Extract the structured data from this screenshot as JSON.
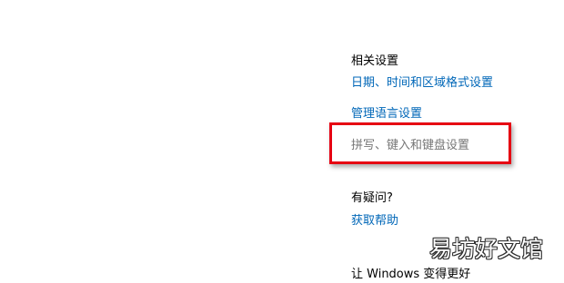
{
  "related_settings": {
    "title": "相关设置",
    "links": {
      "date_time_region": "日期、时间和区域格式设置",
      "manage_language": "管理语言设置",
      "spelling_typing_keyboard": "拼写、键入和键盘设置"
    }
  },
  "help": {
    "title": "有疑问?",
    "get_help": "获取帮助"
  },
  "improve": {
    "title": "让 Windows 变得更好"
  },
  "watermark": {
    "text": "易坊好文馆"
  },
  "colors": {
    "link": "#0067b8",
    "disabled_link": "#767676",
    "highlight": "#e60012"
  }
}
